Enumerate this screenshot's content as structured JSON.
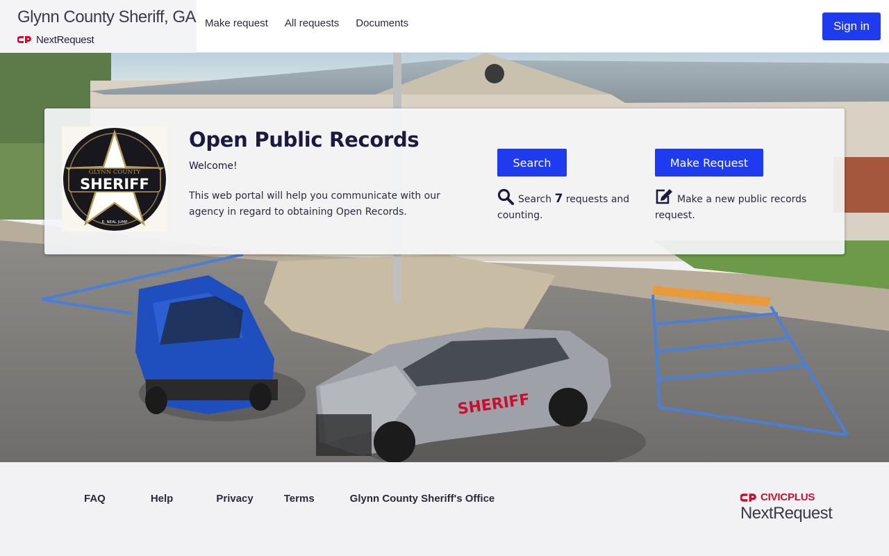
{
  "header": {
    "site_title": "Glynn County Sheriff, GA",
    "platform_name": "NextRequest",
    "nav": [
      "Make request",
      "All requests",
      "Documents"
    ],
    "sign_in_label": "Sign in"
  },
  "hero": {
    "title": "Open Public Records",
    "welcome": "Welcome!",
    "description": "This web portal will help you communicate with our agency in regard to obtaining Open Records.",
    "badge": {
      "top_text": "GLYNN COUNTY",
      "main_text": "SHERIFF",
      "bottom_text": "E. NEAL JUMP"
    },
    "search_button": "Search",
    "search_prefix": "Search",
    "request_count": "7",
    "search_suffix": "requests and counting.",
    "make_request_button": "Make Request",
    "make_request_text": "Make a new public records request."
  },
  "footer": {
    "links": [
      "FAQ",
      "Help",
      "Privacy",
      "Terms",
      "Glynn County Sheriff's Office"
    ],
    "vendor": "CIVICPLUS",
    "product": "NextRequest"
  },
  "colors": {
    "accent": "#1f3bef",
    "brand_red": "#c8102e",
    "heading": "#1a1a40"
  },
  "icons": [
    "nextrequest-logo-icon",
    "search-icon",
    "edit-icon",
    "civicplus-logo-icon"
  ]
}
